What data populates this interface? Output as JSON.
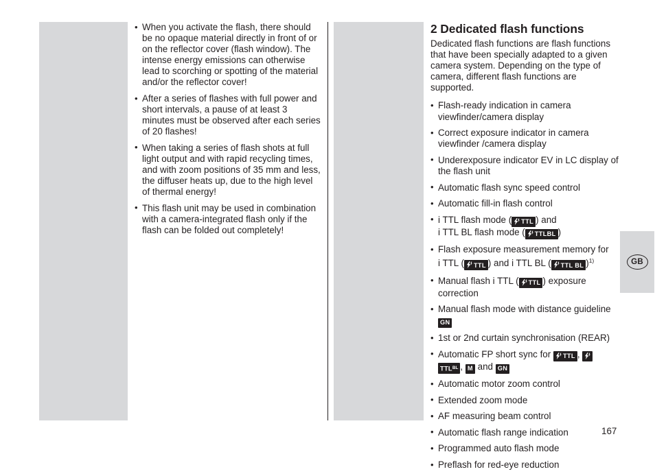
{
  "page": {
    "number": "167",
    "language_tab": "GB"
  },
  "left_column": {
    "bullets": [
      "When you activate the flash, there should be no opaque material directly in front of or on the reflector cover (flash window). The intense energy emissions can otherwise lead to scorching or spotting of the material and/or the reflector cover!",
      "After a series of flashes with full power and short intervals, a pause of at least 3 minutes must be observed after each series of 20 flashes!",
      "When taking a series of flash shots at full light output and with rapid recycling times, and with zoom positions of 35 mm and less, the diffuser heats up, due to the high level of thermal energy!",
      "This flash unit may be used in combination with a camera-integrated flash only if the flash can be folded out completely!"
    ]
  },
  "right_column": {
    "heading": "2 Dedicated flash functions",
    "intro": "Dedicated flash functions are flash functions that have been specially adapted to a given camera system. Depending on the type of camera, different flash functions are supported.",
    "bullets": {
      "b1": "Flash-ready indication in camera viewfinder/camera display",
      "b2": "Correct exposure indicator in camera viewfinder /camera display",
      "b3": "Underexposure indicator EV in LC display of the flash unit",
      "b4": "Automatic flash sync speed control",
      "b5": "Automatic fill-in flash control",
      "b6_part1": "i TTL flash mode (",
      "b6_part2": ") and",
      "b6_part3": "i TTL BL flash mode (",
      "b6_part4": ")",
      "b7_part1": "Flash exposure measurement memory for",
      "b7_part2": "i TTL (",
      "b7_part3": ") and i TTL BL (",
      "b7_part4": ")",
      "b7_footnote": "1)",
      "b8_part1": "Manual flash i TTL (",
      "b8_part2": ") exposure correction",
      "b9_part1": "Manual flash mode with distance guideline",
      "b10": "1st or 2nd curtain synchronisation (REAR)",
      "b11_part1": "Automatic FP short sync for",
      "b11_comma": ",",
      "b11_and": "and",
      "b12": "Automatic motor zoom control",
      "b13": "Extended zoom mode",
      "b14": "AF measuring beam control",
      "b15": "Automatic flash range indication",
      "b16": "Programmed auto flash mode",
      "b17": "Preflash for red-eye reduction"
    },
    "badges": {
      "ttl": "TTL",
      "ttlbl_joined": "TTLBL",
      "ttl_bl_spaced": "TTL BL",
      "ttl_sup_bl_main": "TTL",
      "ttl_sup_bl_sup": "BL",
      "gn": "GN",
      "m": "M"
    }
  },
  "colors": {
    "text": "#231f20",
    "grey_block": "#d7d8da",
    "badge_bg": "#231f20",
    "badge_fg": "#ffffff",
    "page_bg": "#ffffff"
  }
}
